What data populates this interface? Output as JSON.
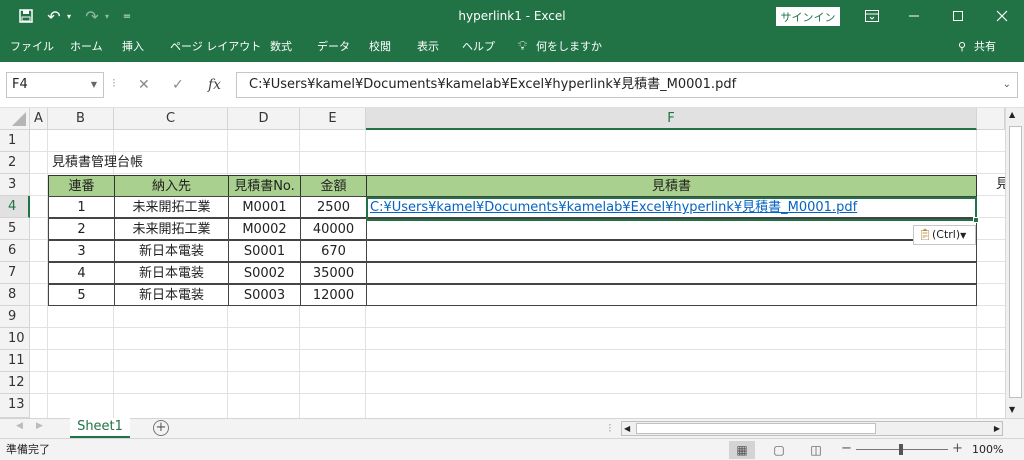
{
  "window": {
    "title": "hyperlink1  -  Excel",
    "signin_label": "サインイン",
    "qat_more": "="
  },
  "ribbon": {
    "tabs": [
      "ファイル",
      "ホーム",
      "挿入",
      "ページ レイアウト",
      "数式",
      "データ",
      "校閲",
      "表示",
      "ヘルプ"
    ],
    "tell_me": "何をしますか",
    "share_label": "共有"
  },
  "formula_bar": {
    "name_box": "F4",
    "formula": "C:¥Users¥kamel¥Documents¥kamelab¥Excel¥hyperlink¥見積書_M0001.pdf",
    "fx": "fx"
  },
  "grid": {
    "columns": [
      "A",
      "B",
      "C",
      "D",
      "E",
      "F"
    ],
    "rows": [
      "1",
      "2",
      "3",
      "4",
      "5",
      "6",
      "7",
      "8",
      "9",
      "10",
      "11",
      "12",
      "13"
    ],
    "selected_column": "F",
    "selected_row": "4",
    "next_column_cut": "見"
  },
  "sheet": {
    "title": "見積書管理台帳",
    "headers": [
      "連番",
      "納入先",
      "見積書No.",
      "金額",
      "見積書"
    ],
    "rows": [
      [
        "1",
        "未来開拓工業",
        "M0001",
        "2500",
        "C:¥Users¥kamel¥Documents¥kamelab¥Excel¥hyperlink¥見積書_M0001.pdf"
      ],
      [
        "2",
        "未来開拓工業",
        "M0002",
        "40000",
        ""
      ],
      [
        "3",
        "新日本電装",
        "S0001",
        "670",
        ""
      ],
      [
        "4",
        "新日本電装",
        "S0002",
        "35000",
        ""
      ],
      [
        "5",
        "新日本電装",
        "S0003",
        "12000",
        ""
      ]
    ]
  },
  "paste_options": "(Ctrl)",
  "sheet_tabs": {
    "active": "Sheet1"
  },
  "status": {
    "text": "準備完了",
    "zoom": "100%"
  },
  "colors": {
    "excel_green": "#217346",
    "header_fill": "#a9d08e",
    "link": "#0563c1"
  }
}
